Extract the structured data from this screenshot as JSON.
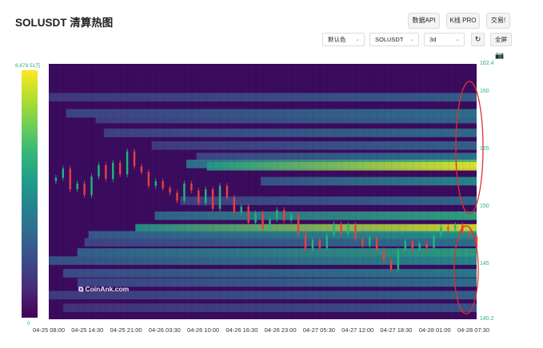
{
  "header": {
    "title": "SOLUSDT 清算热图",
    "btn_data": "数据API",
    "btn_kline": "K线 PRO",
    "btn_trade": "交易!"
  },
  "controls": {
    "color_scheme": "默认色",
    "symbol": "SOLUSDT",
    "interval": "3d",
    "refresh_icon": "refresh-icon",
    "fullscreen": "全屏",
    "camera_icon": "camera-icon"
  },
  "colorbar": {
    "max_label": "8,678.51万",
    "min_label": "0"
  },
  "watermark": {
    "text": "CoinAnk.com"
  },
  "chart_data": {
    "type": "heatmap",
    "y_range": [
      140.2,
      162.4
    ],
    "y_ticks_right": [
      {
        "value": 162.4,
        "label": "162.4"
      },
      {
        "value": 160,
        "label": "160"
      },
      {
        "value": 155,
        "label": "155"
      },
      {
        "value": 150,
        "label": "150"
      },
      {
        "value": 145,
        "label": "145"
      },
      {
        "value": 140.2,
        "label": "140.2"
      }
    ],
    "x_tick_labels": [
      "04-25 08:00",
      "04-25 14:30",
      "04-25 21:00",
      "04-26 03:30",
      "04-26 10:00",
      "04-26 16:30",
      "04-26 23:00",
      "04-27 05:30",
      "04-27 12:00",
      "04-27 18:30",
      "04-28 01:00",
      "04-28 07:30"
    ],
    "price_path": [
      [
        0,
        152.2
      ],
      [
        2,
        152.5
      ],
      [
        4,
        153.3
      ],
      [
        6,
        151.5
      ],
      [
        8,
        152.0
      ],
      [
        10,
        151.0
      ],
      [
        12,
        152.6
      ],
      [
        14,
        153.6
      ],
      [
        16,
        152.4
      ],
      [
        18,
        153.8
      ],
      [
        20,
        152.8
      ],
      [
        22,
        154.8
      ],
      [
        24,
        153.5
      ],
      [
        26,
        153.0
      ],
      [
        28,
        151.8
      ],
      [
        30,
        152.2
      ],
      [
        32,
        151.6
      ],
      [
        34,
        151.2
      ],
      [
        36,
        150.5
      ],
      [
        38,
        152.0
      ],
      [
        40,
        151.4
      ],
      [
        42,
        150.3
      ],
      [
        44,
        151.5
      ],
      [
        46,
        149.8
      ],
      [
        48,
        151.8
      ],
      [
        50,
        150.8
      ],
      [
        52,
        149.5
      ],
      [
        54,
        150.0
      ],
      [
        56,
        148.6
      ],
      [
        58,
        149.4
      ],
      [
        60,
        148.1
      ],
      [
        62,
        148.9
      ],
      [
        64,
        149.7
      ],
      [
        66,
        148.8
      ],
      [
        68,
        149.3
      ],
      [
        70,
        147.6
      ],
      [
        72,
        146.3
      ],
      [
        74,
        147.1
      ],
      [
        76,
        146.4
      ],
      [
        78,
        147.5
      ],
      [
        80,
        148.5
      ],
      [
        82,
        147.6
      ],
      [
        84,
        148.4
      ],
      [
        86,
        147.2
      ],
      [
        88,
        146.6
      ],
      [
        90,
        147.3
      ],
      [
        92,
        146.2
      ],
      [
        94,
        145.3
      ],
      [
        96,
        144.5
      ],
      [
        98,
        146.2
      ],
      [
        100,
        147.0
      ],
      [
        102,
        146.3
      ],
      [
        104,
        146.8
      ],
      [
        106,
        146.4
      ],
      [
        108,
        147.5
      ],
      [
        110,
        148.2
      ],
      [
        112,
        148.0
      ],
      [
        114,
        148.4
      ],
      [
        116,
        147.7
      ],
      [
        118,
        147.4
      ],
      [
        120,
        146.5
      ]
    ],
    "heat_bands": [
      {
        "price": 159.5,
        "intensity": 0.32
      },
      {
        "price": 158.1,
        "intensity": 0.4
      },
      {
        "price": 157.6,
        "intensity": 0.36
      },
      {
        "price": 156.4,
        "intensity": 0.38
      },
      {
        "price": 155.3,
        "intensity": 0.34
      },
      {
        "price": 154.3,
        "intensity": 0.42
      },
      {
        "price": 153.7,
        "intensity": 0.72
      },
      {
        "price": 153.5,
        "intensity": 0.97
      },
      {
        "price": 152.2,
        "intensity": 0.5
      },
      {
        "price": 150.5,
        "intensity": 0.36
      },
      {
        "price": 149.2,
        "intensity": 0.62
      },
      {
        "price": 148.1,
        "intensity": 0.95
      },
      {
        "price": 147.5,
        "intensity": 0.55
      },
      {
        "price": 146.9,
        "intensity": 0.4
      },
      {
        "price": 146.0,
        "intensity": 0.6
      },
      {
        "price": 145.3,
        "intensity": 0.5
      },
      {
        "price": 144.2,
        "intensity": 0.45
      },
      {
        "price": 143.4,
        "intensity": 0.4
      },
      {
        "price": 142.3,
        "intensity": 0.34
      },
      {
        "price": 141.2,
        "intensity": 0.28
      }
    ],
    "colors": {
      "candle_up": "#1cb87e",
      "candle_down": "#e8413c",
      "annotation": "#e03030"
    }
  }
}
